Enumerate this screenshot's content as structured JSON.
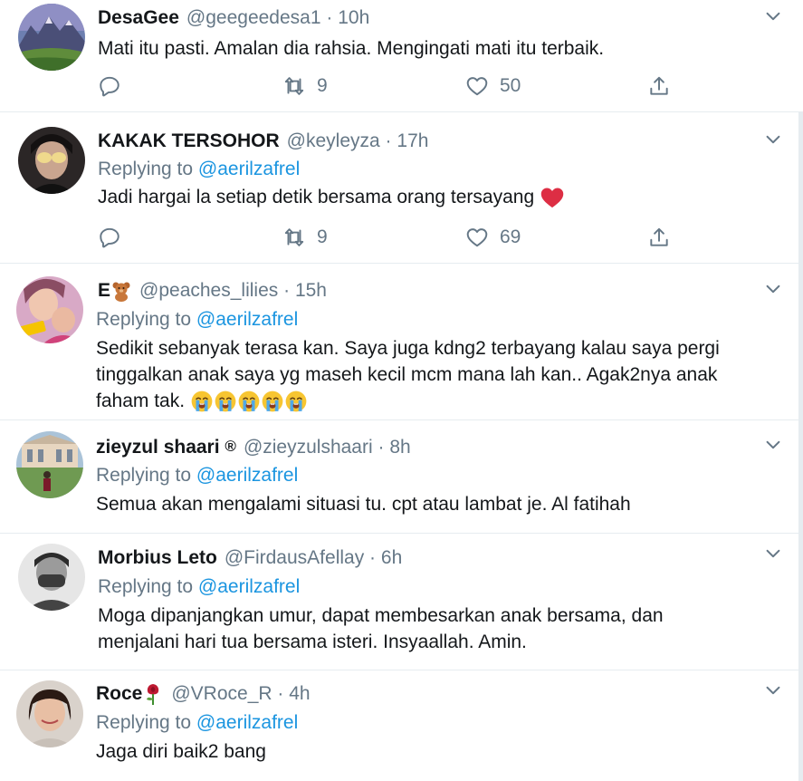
{
  "tweets": [
    {
      "name": "DesaGee",
      "handle": "@geegeedesa1",
      "time": "10h",
      "body": [
        "Mati itu pasti. Amalan dia rahsia. Mengingati mati itu terbaik."
      ],
      "retweets": "9",
      "likes": "50",
      "avatar_icon": "mountain-landscape"
    },
    {
      "name": "KAKAK TERSOHOR",
      "handle": "@keyleyza",
      "time": "17h",
      "replying_label": "Replying to",
      "replying_to": "@aerilzafrel",
      "body": [
        "Jadi hargai la setiap detik bersama orang tersayang"
      ],
      "body_emoji": "red-heart",
      "retweets": "9",
      "likes": "69"
    },
    {
      "name": "E",
      "name_emoji": "teddy-bear",
      "handle": "@peaches_lilies",
      "time": "15h",
      "replying_label": "Replying to",
      "replying_to": "@aerilzafrel",
      "body": [
        "Sedikit sebanyak terasa kan. Saya juga kdng2 terbayang kalau saya pergi",
        "tinggalkan anak saya yg maseh kecil mcm mana lah kan.. Agak2nya anak",
        "faham tak."
      ],
      "body_emoji": "crying-face x5"
    },
    {
      "name": "zieyzul shaari",
      "name_symbol": "®",
      "handle": "@zieyzulshaari",
      "time": "8h",
      "replying_label": "Replying to",
      "replying_to": "@aerilzafrel",
      "body": [
        "Semua akan mengalami situasi tu. cpt atau lambat je. Al fatihah"
      ]
    },
    {
      "name": "Morbius Leto",
      "handle": "@FirdausAfellay",
      "time": "6h",
      "replying_label": "Replying to",
      "replying_to": "@aerilzafrel",
      "body": [
        "Moga dipanjangkan umur, dapat membesarkan anak bersama, dan",
        "menjalani hari tua bersama isteri. Insyaallah. Amin."
      ]
    },
    {
      "name": "Roce",
      "name_emoji": "rose",
      "handle": "@VRoce_R",
      "time": "4h",
      "replying_label": "Replying to",
      "replying_to": "@aerilzafrel",
      "body": [
        "Jaga diri baik2 bang"
      ]
    }
  ],
  "dot": "·",
  "colors": {
    "link": "#1b95e0",
    "secondary": "#657786",
    "text": "#14171a",
    "divider": "#e6ecf0"
  }
}
